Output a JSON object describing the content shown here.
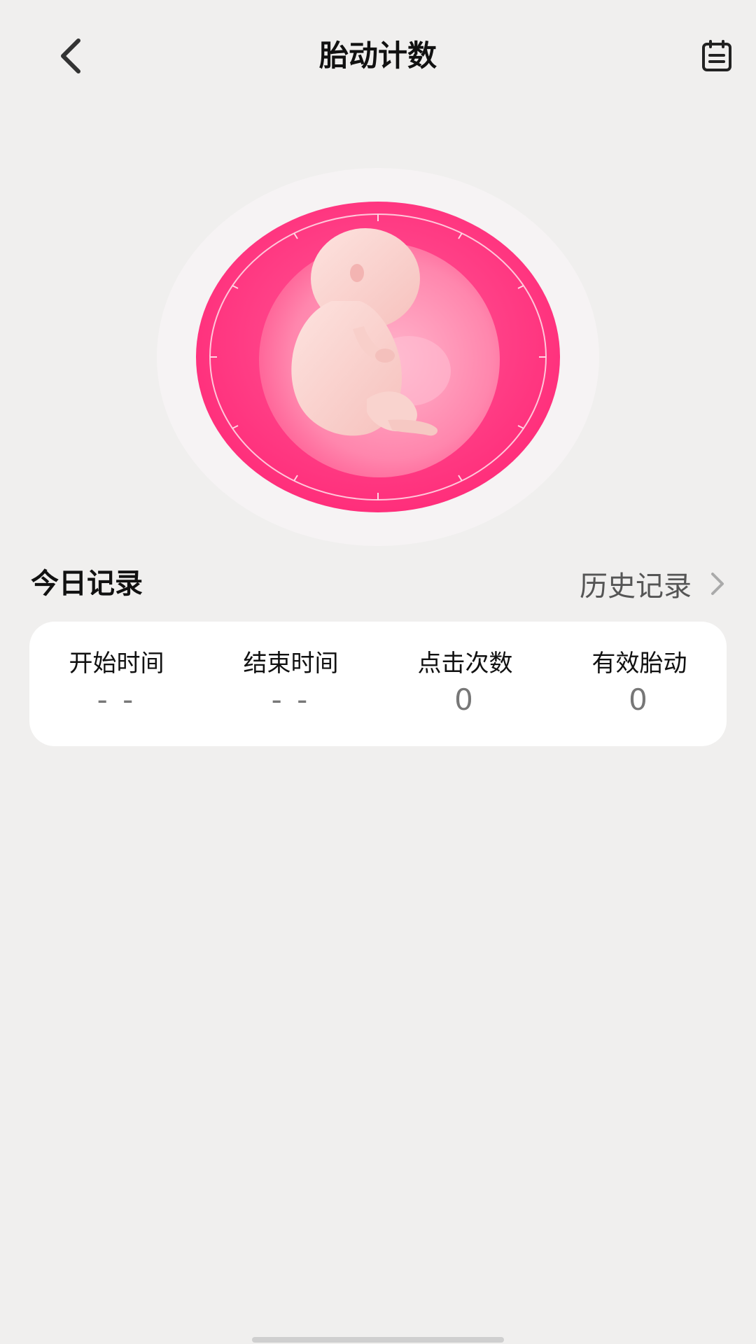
{
  "header": {
    "title": "胎动计数",
    "back_icon": "chevron-left-icon",
    "calendar_icon": "calendar-list-icon"
  },
  "counter": {
    "illustration": "fetus-in-womb",
    "colors": {
      "halo": "#f6f3f4",
      "outer": "#ff3d84",
      "inner": "#ff86ad"
    }
  },
  "today": {
    "title": "今日记录",
    "history_label": "历史记录"
  },
  "stats": [
    {
      "label": "开始时间",
      "value": "- -"
    },
    {
      "label": "结束时间",
      "value": "- -"
    },
    {
      "label": "点击次数",
      "value": "0"
    },
    {
      "label": "有效胎动",
      "value": "0"
    }
  ]
}
